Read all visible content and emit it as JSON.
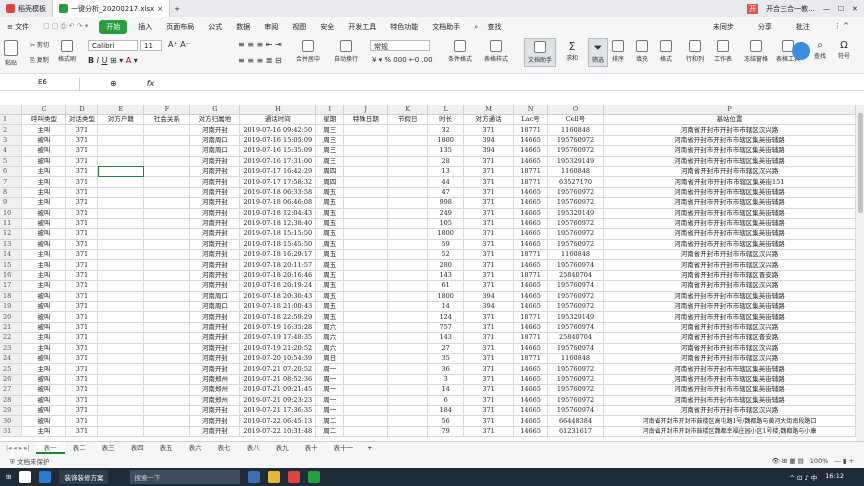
{
  "titlebar": {
    "tabs": [
      {
        "label": "稻壳模板",
        "color": "#d44"
      },
      {
        "label": "一键分析_20200217.xlsx",
        "color": "#2a9d40"
      }
    ],
    "right_badge": "开",
    "right_text": "开合三合一教..."
  },
  "menubar": {
    "file": "≡ 文件",
    "items": [
      "开始",
      "插入",
      "页面布局",
      "公式",
      "数据",
      "审阅",
      "视图",
      "安全",
      "开发工具",
      "特色功能",
      "文档助手",
      "查找"
    ],
    "right": [
      "未同步",
      "分享",
      "批注"
    ]
  },
  "ribbon": {
    "paste": "粘贴",
    "cut": "剪切",
    "copy": "复制",
    "format_painter": "格式刷",
    "font": "Calibri",
    "size": "11",
    "merge": "合并居中",
    "wrap": "自动换行",
    "number_format": "常规",
    "cond_format": "条件格式",
    "table_style": "表格样式",
    "doc_helper": "文档助手",
    "sum": "求和",
    "filter": "筛选",
    "sort": "排序",
    "fill": "填充",
    "format": "格式",
    "rowcol": "行和列",
    "worksheet": "工作表",
    "freeze": "冻结窗格",
    "tools": "表格工具",
    "find": "查找",
    "symbol": "符号"
  },
  "formula": {
    "cell": "E6",
    "fx": "fx"
  },
  "columns": [
    "",
    "C",
    "D",
    "E",
    "F",
    "G",
    "H",
    "I",
    "J",
    "K",
    "L",
    "M",
    "N",
    "O",
    "P"
  ],
  "header_row": [
    "呼叫类型",
    "对话类型",
    "对方户籍",
    "社会关系",
    "对方归属地",
    "通话时间",
    "星期",
    "特殊日期",
    "节假日",
    "时长",
    "对方通话",
    "Lac号",
    "Cell号",
    "基站位置"
  ],
  "rows": [
    [
      "2",
      "主叫",
      "371",
      "",
      "",
      "河南开封",
      "2019-07-16 09:42:50",
      "周三",
      "",
      "",
      "32",
      "371",
      "18771",
      "1160848",
      "河南省开封市开封市市辖区汉兴路"
    ],
    [
      "3",
      "被叫",
      "371",
      "",
      "",
      "河南周口",
      "2019-07-16 15:05:09",
      "周三",
      "",
      "",
      "1800",
      "394",
      "14665",
      "195760972",
      "河南省开封市开封市市辖区集英街辅路"
    ],
    [
      "4",
      "被叫",
      "371",
      "",
      "",
      "河南周口",
      "2019-07-16 15:35:09",
      "周三",
      "",
      "",
      "135",
      "394",
      "14665",
      "195760972",
      "河南省开封市开封市市辖区集英街辅路"
    ],
    [
      "5",
      "被叫",
      "371",
      "",
      "",
      "河南开封",
      "2019-07-16 17:31:00",
      "周三",
      "",
      "",
      "28",
      "371",
      "14665",
      "195329149",
      "河南省开封市开封市市辖区集英街辅路"
    ],
    [
      "6",
      "主叫",
      "371",
      "",
      "",
      "河南开封",
      "2019-07-17 16:42:29",
      "周四",
      "",
      "",
      "13",
      "371",
      "18771",
      "1160848",
      "河南省开封市开封市市辖区汉兴路"
    ],
    [
      "7",
      "主叫",
      "371",
      "",
      "",
      "河南开封",
      "2019-07-17 17:58:32",
      "周四",
      "",
      "",
      "44",
      "371",
      "18771",
      "63527170",
      "河南省开封市开封市市辖区集英街151"
    ],
    [
      "8",
      "主叫",
      "371",
      "",
      "",
      "河南开封",
      "2019-07-18 06:33:58",
      "周五",
      "",
      "",
      "47",
      "371",
      "14665",
      "195760972",
      "河南省开封市开封市市辖区集英街辅路"
    ],
    [
      "9",
      "主叫",
      "371",
      "",
      "",
      "河南开封",
      "2019-07-18 06:46:08",
      "周五",
      "",
      "",
      "998",
      "371",
      "14665",
      "195760972",
      "河南省开封市开封市市辖区集英街辅路"
    ],
    [
      "10",
      "被叫",
      "371",
      "",
      "",
      "河南开封",
      "2019-07-18 12:04:43",
      "周五",
      "",
      "",
      "249",
      "371",
      "14665",
      "195329149",
      "河南省开封市开封市市辖区集英街辅路"
    ],
    [
      "11",
      "被叫",
      "371",
      "",
      "",
      "河南开封",
      "2019-07-18 12:38:40",
      "周五",
      "",
      "",
      "105",
      "371",
      "14665",
      "195760972",
      "河南省开封市开封市市辖区集英街辅路"
    ],
    [
      "12",
      "被叫",
      "371",
      "",
      "",
      "河南开封",
      "2019-07-18 15:15:50",
      "周五",
      "",
      "",
      "1800",
      "371",
      "14665",
      "195760972",
      "河南省开封市开封市市辖区集英街辅路"
    ],
    [
      "13",
      "被叫",
      "371",
      "",
      "",
      "河南开封",
      "2019-07-18 15:45:50",
      "周五",
      "",
      "",
      "59",
      "371",
      "14665",
      "195760972",
      "河南省开封市开封市市辖区集英街辅路"
    ],
    [
      "14",
      "主叫",
      "371",
      "",
      "",
      "河南开封",
      "2019-07-18 16:29:17",
      "周五",
      "",
      "",
      "52",
      "371",
      "18771",
      "1160848",
      "河南省开封市开封市市辖区汉兴路"
    ],
    [
      "15",
      "主叫",
      "371",
      "",
      "",
      "河南开封",
      "2019-07-18 20:11:57",
      "周五",
      "",
      "",
      "280",
      "371",
      "14665",
      "195760974",
      "河南省开封市开封市市辖区汉兴路"
    ],
    [
      "16",
      "主叫",
      "371",
      "",
      "",
      "河南开封",
      "2019-07-18 20:16:46",
      "周五",
      "",
      "",
      "143",
      "371",
      "18771",
      "25840704",
      "河南省开封市开封市市辖区晋安路"
    ],
    [
      "17",
      "主叫",
      "371",
      "",
      "",
      "河南开封",
      "2019-07-18 20:19:24",
      "周五",
      "",
      "",
      "61",
      "371",
      "14665",
      "195760974",
      "河南省开封市开封市市辖区汉兴路"
    ],
    [
      "18",
      "被叫",
      "371",
      "",
      "",
      "河南周口",
      "2019-07-18 20:30:43",
      "周五",
      "",
      "",
      "1800",
      "394",
      "14665",
      "195760972",
      "河南省开封市开封市市辖区集英街辅路"
    ],
    [
      "19",
      "被叫",
      "371",
      "",
      "",
      "河南周口",
      "2019-07-18 21:00:43",
      "周五",
      "",
      "",
      "14",
      "394",
      "14665",
      "195760972",
      "河南省开封市开封市市辖区集英街辅路"
    ],
    [
      "20",
      "被叫",
      "371",
      "",
      "",
      "河南开封",
      "2019-07-18 22:59:29",
      "周五",
      "",
      "",
      "124",
      "371",
      "18771",
      "195329149",
      "河南省开封市开封市市辖区集英街辅路"
    ],
    [
      "21",
      "被叫",
      "371",
      "",
      "",
      "河南开封",
      "2019-07-19 16:35:28",
      "周六",
      "",
      "",
      "757",
      "371",
      "14665",
      "195760974",
      "河南省开封市开封市市辖区汉兴路"
    ],
    [
      "22",
      "主叫",
      "371",
      "",
      "",
      "河南开封",
      "2019-07-19 17:48:35",
      "周六",
      "",
      "",
      "143",
      "371",
      "18771",
      "25840704",
      "河南省开封市开封市市辖区晋安路"
    ],
    [
      "23",
      "主叫",
      "371",
      "",
      "",
      "河南开封",
      "2019-07-19 21:20:52",
      "周六",
      "",
      "",
      "27",
      "371",
      "14665",
      "195760974",
      "河南省开封市开封市市辖区汉兴路"
    ],
    [
      "24",
      "被叫",
      "371",
      "",
      "",
      "河南开封",
      "2019-07-20 10:54:39",
      "周日",
      "",
      "",
      "35",
      "371",
      "18771",
      "1160848",
      "河南省开封市开封市市辖区汉兴路"
    ],
    [
      "25",
      "主叫",
      "371",
      "",
      "",
      "河南开封",
      "2019-07-21 07:20:52",
      "周一",
      "",
      "",
      "36",
      "371",
      "14665",
      "195760972",
      "河南省开封市开封市市辖区集英街辅路"
    ],
    [
      "26",
      "被叫",
      "371",
      "",
      "",
      "河南郑州",
      "2019-07-21 08:52:36",
      "周一",
      "",
      "",
      "3",
      "371",
      "14665",
      "195760972",
      "河南省开封市开封市市辖区集英街辅路"
    ],
    [
      "27",
      "被叫",
      "371",
      "",
      "",
      "河南郑州",
      "2019-07-21 09:21:45",
      "周一",
      "",
      "",
      "14",
      "371",
      "14665",
      "195760972",
      "河南省开封市开封市市辖区集英街辅路"
    ],
    [
      "28",
      "被叫",
      "371",
      "",
      "",
      "河南郑州",
      "2019-07-21 09:23:23",
      "周一",
      "",
      "",
      "6",
      "371",
      "14665",
      "195760972",
      "河南省开封市开封市市辖区集英街辅路"
    ],
    [
      "29",
      "被叫",
      "371",
      "",
      "",
      "河南开封",
      "2019-07-21 17:36:35",
      "周一",
      "",
      "",
      "184",
      "371",
      "14665",
      "195760974",
      "河南省开封市开封市市辖区汉兴路"
    ],
    [
      "30",
      "被叫",
      "371",
      "",
      "",
      "河南开封",
      "2019-07-22 06:45:13",
      "周二",
      "",
      "",
      "56",
      "371",
      "14665",
      "66448384",
      "河南省开封市开封市鼓楼区高屯路1号/魏都路与黄河大街南段路口"
    ],
    [
      "31",
      "主叫",
      "371",
      "",
      "",
      "河南开封",
      "2019-07-22 10:31:48",
      "周二",
      "",
      "",
      "79",
      "371",
      "14665",
      "61231617",
      "河南省开封市开封市鼓楼区魏都幸福庄园小区1号楼;魏都路与小康"
    ]
  ],
  "sheets": [
    "表一",
    "表二",
    "表三",
    "表四",
    "表五",
    "表六",
    "表七",
    "表八",
    "表九",
    "表十",
    "表十一"
  ],
  "status": {
    "left": "文档未保护",
    "zoom": "100%"
  },
  "taskbar": {
    "search": "搜索一下",
    "app": "装饰装修方案",
    "time": "16:12"
  }
}
